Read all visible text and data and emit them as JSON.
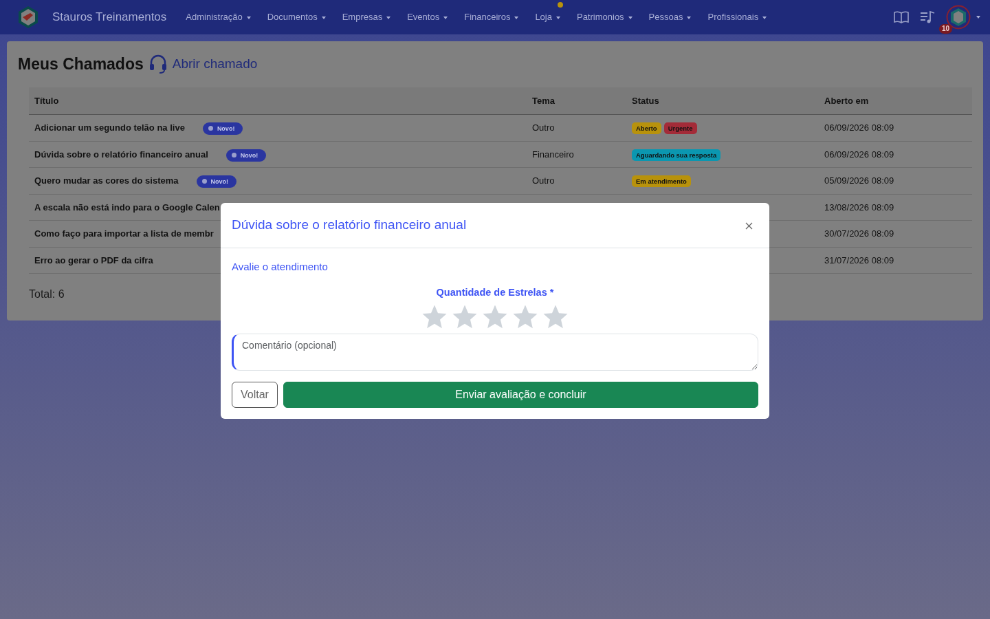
{
  "navbar": {
    "brand": "Stauros Treinamentos",
    "menus": [
      {
        "label": "Administração",
        "dot": false
      },
      {
        "label": "Documentos",
        "dot": false
      },
      {
        "label": "Empresas",
        "dot": false
      },
      {
        "label": "Eventos",
        "dot": false
      },
      {
        "label": "Financeiros",
        "dot": false
      },
      {
        "label": "Loja",
        "dot": true
      },
      {
        "label": "Patrimonios",
        "dot": false
      },
      {
        "label": "Pessoas",
        "dot": false
      },
      {
        "label": "Profissionais",
        "dot": false
      }
    ],
    "notifications": "10"
  },
  "page": {
    "title": "Meus Chamados",
    "open_link": "Abrir chamado",
    "total": "Total: 6"
  },
  "table": {
    "columns": [
      "Título",
      "Tema",
      "Status",
      "Aberto em"
    ],
    "rows": [
      {
        "title": "Adicionar um segundo telão na live",
        "new_badge": "Novo!",
        "theme": "Outro",
        "statuses": [
          {
            "label": "Aberto",
            "color": "#b8920c"
          },
          {
            "label": "Urgente",
            "color": "#a32b38"
          }
        ],
        "opened": "06/09/2026 08:09"
      },
      {
        "title": "Dúvida sobre o relatório financeiro anual",
        "new_badge": "Novo!",
        "theme": "Financeiro",
        "statuses": [
          {
            "label": "Aguardando sua resposta",
            "color": "#0b97b0"
          }
        ],
        "opened": "06/09/2026 08:09"
      },
      {
        "title": "Quero mudar as cores do sistema",
        "new_badge": "Novo!",
        "theme": "Outro",
        "statuses": [
          {
            "label": "Em atendimento",
            "color": "#b8920c"
          }
        ],
        "opened": "05/09/2026 08:09"
      },
      {
        "title": "A escala não está indo para o Google Calen",
        "opened": "13/08/2026 08:09"
      },
      {
        "title": "Como faço para importar a lista de membr",
        "opened": "30/07/2026 08:09"
      },
      {
        "title": "Erro ao gerar o PDF da cifra",
        "opened": "31/07/2026 08:09"
      }
    ]
  },
  "modal": {
    "title": "Dúvida sobre o relatório financeiro anual",
    "subtitle": "Avalie o atendimento",
    "rating_label": "Quantidade de Estrelas *",
    "stars": 0,
    "comment_placeholder": "Comentário (opcional)",
    "back_button": "Voltar",
    "submit_button": "Enviar avaliação e concluir"
  }
}
